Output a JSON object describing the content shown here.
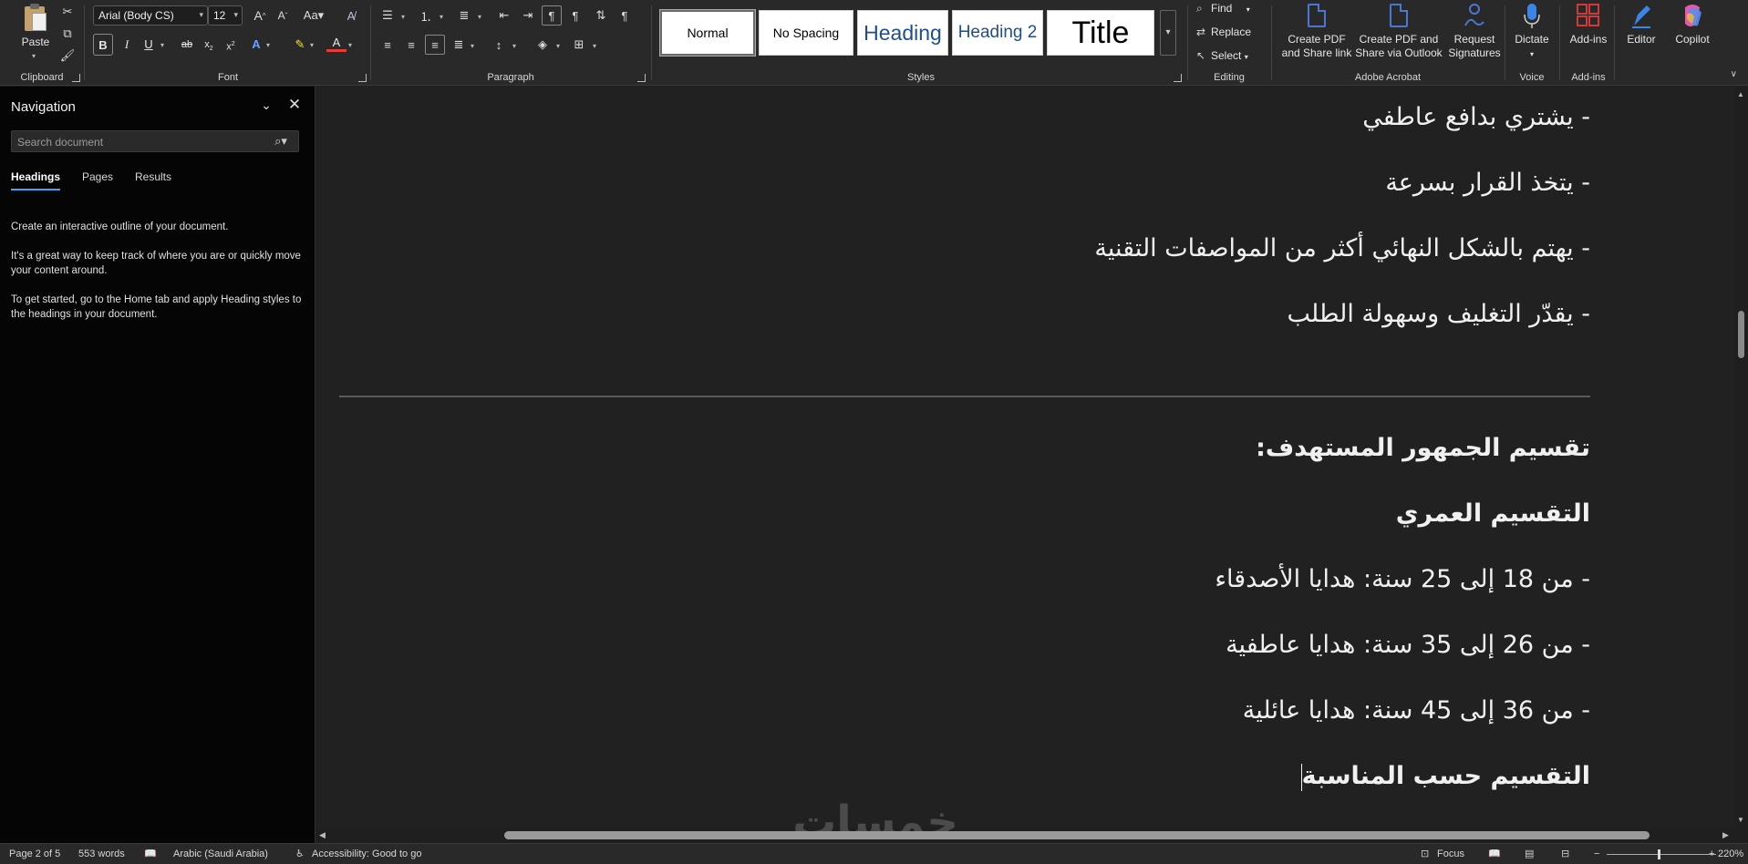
{
  "ribbon": {
    "clipboard": {
      "label": "Clipboard",
      "paste": "Paste"
    },
    "font": {
      "label": "Font",
      "font_name": "Arial (Body CS)",
      "font_size": "12"
    },
    "paragraph": {
      "label": "Paragraph"
    },
    "styles": {
      "label": "Styles",
      "items": [
        "Normal",
        "No Spacing",
        "Heading",
        "Heading 2",
        "Title"
      ],
      "selected": "Normal"
    },
    "editing": {
      "label": "Editing",
      "find": "Find",
      "replace": "Replace",
      "select": "Select"
    },
    "acrobat": {
      "label": "Adobe Acrobat",
      "create_pdf_share_link": [
        "Create PDF",
        "and Share link"
      ],
      "create_pdf_outlook": [
        "Create PDF and",
        "Share via Outlook"
      ],
      "request_signatures": [
        "Request",
        "Signatures"
      ]
    },
    "voice": {
      "label": "Voice",
      "dictate": "Dictate"
    },
    "addins": {
      "label": "Add-ins",
      "addins_btn": "Add-ins"
    },
    "editor": "Editor",
    "copilot": "Copilot"
  },
  "navigation": {
    "title": "Navigation",
    "search_placeholder": "Search document",
    "tabs": [
      "Headings",
      "Pages",
      "Results"
    ],
    "active_tab": "Headings",
    "paragraphs": [
      "Create an interactive outline of your document.",
      "It's a great way to keep track of where you are or quickly move your content around.",
      "To get started, go to the Home tab and apply Heading styles to the headings in your document."
    ]
  },
  "document": {
    "lines_before_rule": [
      "- يشتري بدافع عاطفي",
      "- يتخذ القرار بسرعة",
      "- يهتم بالشكل النهائي أكثر من المواصفات التقنية",
      "- يقدّر التغليف وسهولة الطلب"
    ],
    "section_heading": "تقسيم الجمهور المستهدف:",
    "sub_heading_age": "التقسيم العمري",
    "age_lines": [
      "- من 18 إلى 25 سنة: هدايا الأصدقاء",
      "- من 26 إلى 35 سنة: هدايا عاطفية",
      "- من 36 إلى 45 سنة: هدايا عائلية"
    ],
    "sub_heading_occasion": "التقسيم حسب المناسبة"
  },
  "watermark": {
    "text": "خمسات"
  },
  "status_bar": {
    "page": "Page 2 of 5",
    "words": "553 words",
    "language": "Arabic (Saudi Arabia)",
    "accessibility": "Accessibility: Good to go",
    "focus": "Focus",
    "zoom": "220%"
  },
  "colors": {
    "ribbon_bg": "#292929",
    "doc_bg": "#212121",
    "nav_bg": "#050505",
    "accent_tab": "#4aa0f0",
    "acrobat_blue": "#4a78d0",
    "addins_red": "#d23a3a"
  }
}
